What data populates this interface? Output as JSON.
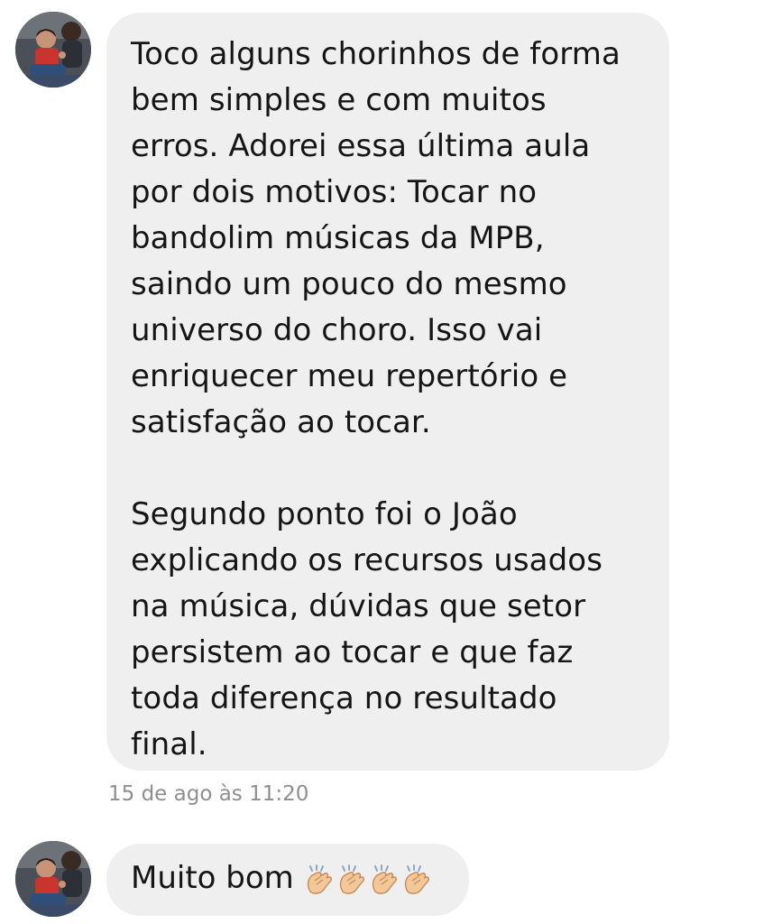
{
  "messages": [
    {
      "text": "Toco alguns chorinhos de forma\nbem simples e com muitos\nerros. Adorei essa última aula\npor dois motivos: Tocar no\nbandolim músicas da MPB,\nsaindo um pouco do mesmo\nuniverso do choro. Isso vai\nenriquecer meu repertório e\nsatisfação ao tocar.\n\n Segundo ponto foi o João\nexplicando os recursos usados\nna música, dúvidas que setor\npersistem ao tocar e que faz\ntoda diferença no resultado\nfinal.",
      "timestamp": "15 de ago às 11:20"
    },
    {
      "text": "Muito bom",
      "emoji": [
        "clapping-hands",
        "clapping-hands",
        "clapping-hands",
        "clapping-hands"
      ]
    }
  ],
  "colors": {
    "bubble": "#efefef",
    "text": "#151515",
    "timestamp": "#8e8e8e",
    "clap": "#f2c79a"
  },
  "icons": {
    "avatar": "user-avatar-photo",
    "clap": "clapping-hands-emoji"
  }
}
